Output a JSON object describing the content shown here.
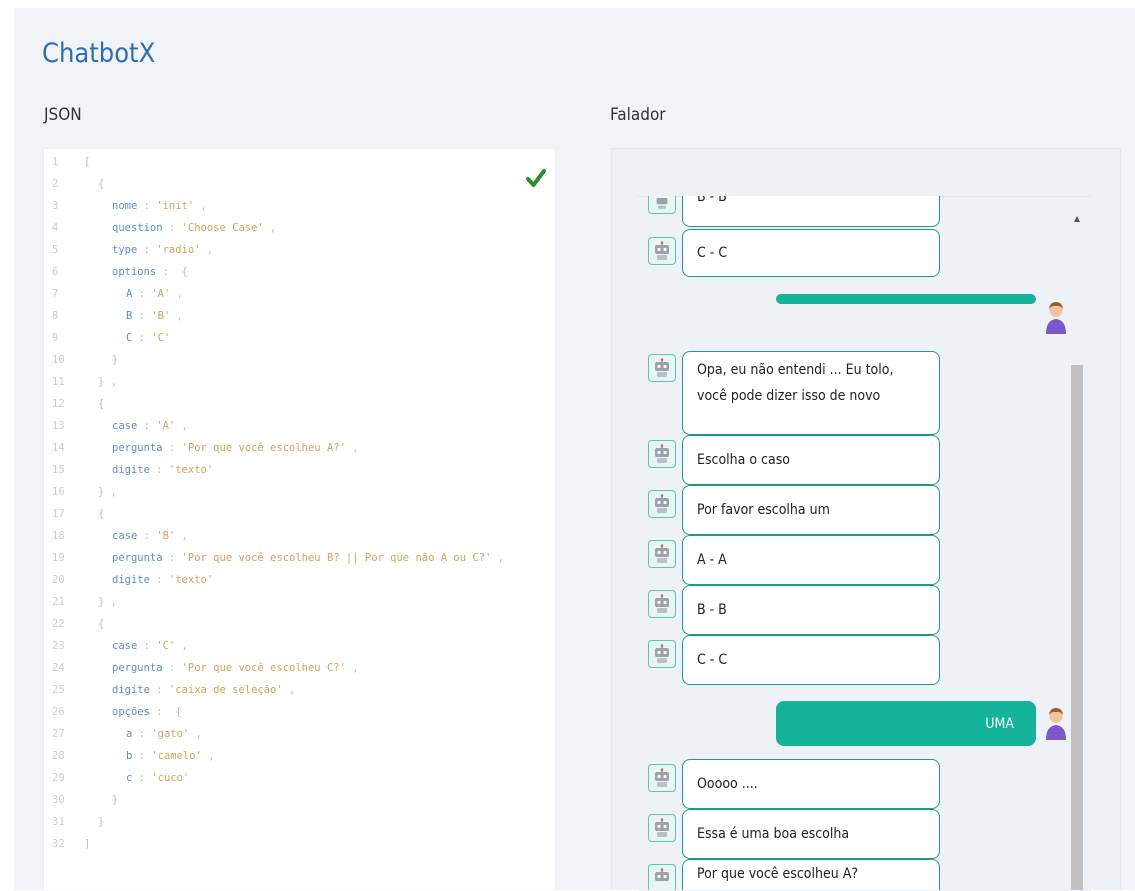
{
  "app": {
    "title": "ChatbotX"
  },
  "sections": {
    "json_label": "JSON",
    "talker_label": "Falador"
  },
  "editor": {
    "valid_icon": "checkmark-icon",
    "lines": [
      {
        "n": "1",
        "indent": 0,
        "type": "p",
        "text": "["
      },
      {
        "n": "2",
        "indent": 1,
        "type": "p",
        "text": "{"
      },
      {
        "n": "3",
        "indent": 2,
        "type": "kv",
        "key": "nome",
        "value": "'init'",
        "trail": " ,"
      },
      {
        "n": "4",
        "indent": 2,
        "type": "kv",
        "key": "question",
        "value": "'Choose Case'",
        "trail": " ,"
      },
      {
        "n": "5",
        "indent": 2,
        "type": "kv",
        "key": "type",
        "value": "'radio'",
        "trail": " ,"
      },
      {
        "n": "6",
        "indent": 2,
        "type": "ko",
        "key": "options",
        "trail": " {"
      },
      {
        "n": "7",
        "indent": 3,
        "type": "kv",
        "key": "A",
        "value": "'A'",
        "trail": " ,"
      },
      {
        "n": "8",
        "indent": 3,
        "type": "kv",
        "key": "B",
        "value": "'B'",
        "trail": " ,"
      },
      {
        "n": "9",
        "indent": 3,
        "type": "kv",
        "key": "C",
        "value": "'C'",
        "trail": ""
      },
      {
        "n": "10",
        "indent": 2,
        "type": "p",
        "text": "}"
      },
      {
        "n": "11",
        "indent": 1,
        "type": "p",
        "text": "} ,"
      },
      {
        "n": "12",
        "indent": 1,
        "type": "p",
        "text": "{"
      },
      {
        "n": "13",
        "indent": 2,
        "type": "kv",
        "key": "case",
        "value": "'A'",
        "trail": " ,"
      },
      {
        "n": "14",
        "indent": 2,
        "type": "kv",
        "key": "pergunta",
        "value": "'Por que você escolheu A?'",
        "trail": " ,"
      },
      {
        "n": "15",
        "indent": 2,
        "type": "kv",
        "key": "digite",
        "value": "'texto'",
        "trail": ""
      },
      {
        "n": "16",
        "indent": 1,
        "type": "p",
        "text": "} ,"
      },
      {
        "n": "17",
        "indent": 1,
        "type": "p",
        "text": "{"
      },
      {
        "n": "18",
        "indent": 2,
        "type": "kv",
        "key": "case",
        "value": "'B'",
        "trail": " ,"
      },
      {
        "n": "19",
        "indent": 2,
        "type": "kv",
        "key": "pergunta",
        "value": "'Por que você escolheu B? || Por que não A ou C?'",
        "trail": " ,"
      },
      {
        "n": "20",
        "indent": 2,
        "type": "kv",
        "key": "digite",
        "value": "'texto'",
        "trail": ""
      },
      {
        "n": "21",
        "indent": 1,
        "type": "p",
        "text": "} ,"
      },
      {
        "n": "22",
        "indent": 1,
        "type": "p",
        "text": "{"
      },
      {
        "n": "23",
        "indent": 2,
        "type": "kv",
        "key": "case",
        "value": "'C'",
        "trail": " ,"
      },
      {
        "n": "24",
        "indent": 2,
        "type": "kv",
        "key": "pergunta",
        "value": "'Por que você escolheu C?'",
        "trail": " ,"
      },
      {
        "n": "25",
        "indent": 2,
        "type": "kv",
        "key": "digite",
        "value": "'caixa de seleção'",
        "trail": " ,"
      },
      {
        "n": "26",
        "indent": 2,
        "type": "ko",
        "key": "opções",
        "trail": " {"
      },
      {
        "n": "27",
        "indent": 3,
        "type": "kv",
        "key": "a",
        "value": "'gato'",
        "trail": " ,"
      },
      {
        "n": "28",
        "indent": 3,
        "type": "kv",
        "key": "b",
        "value": "'camelo'",
        "trail": " ,"
      },
      {
        "n": "29",
        "indent": 3,
        "type": "kv",
        "key": "c",
        "value": "'cuco'",
        "trail": ""
      },
      {
        "n": "30",
        "indent": 2,
        "type": "p",
        "text": "}"
      },
      {
        "n": "31",
        "indent": 1,
        "type": "p",
        "text": "}"
      },
      {
        "n": "32",
        "indent": 0,
        "type": "p",
        "text": "]"
      }
    ]
  },
  "chat": {
    "bot_icon": "robot-icon",
    "user_icon": "user-avatar-icon",
    "messages": [
      {
        "from": "bot",
        "text": "B - B",
        "partial": true
      },
      {
        "from": "bot",
        "text": "C - C"
      },
      {
        "from": "user",
        "text": ""
      },
      {
        "from": "bot",
        "text": "Opa, eu não entendi ... Eu tolo, você pode dizer isso de novo"
      },
      {
        "from": "bot",
        "text": "Escolha o caso"
      },
      {
        "from": "bot",
        "text": "Por favor escolha um"
      },
      {
        "from": "bot",
        "text": "A - A"
      },
      {
        "from": "bot",
        "text": "B - B"
      },
      {
        "from": "bot",
        "text": "C - C"
      },
      {
        "from": "user",
        "text": "UMA"
      },
      {
        "from": "bot",
        "text": "Ooooo ...."
      },
      {
        "from": "bot",
        "text": "Essa é uma boa escolha"
      },
      {
        "from": "bot",
        "text": "Por que você escolheu A?"
      }
    ]
  }
}
